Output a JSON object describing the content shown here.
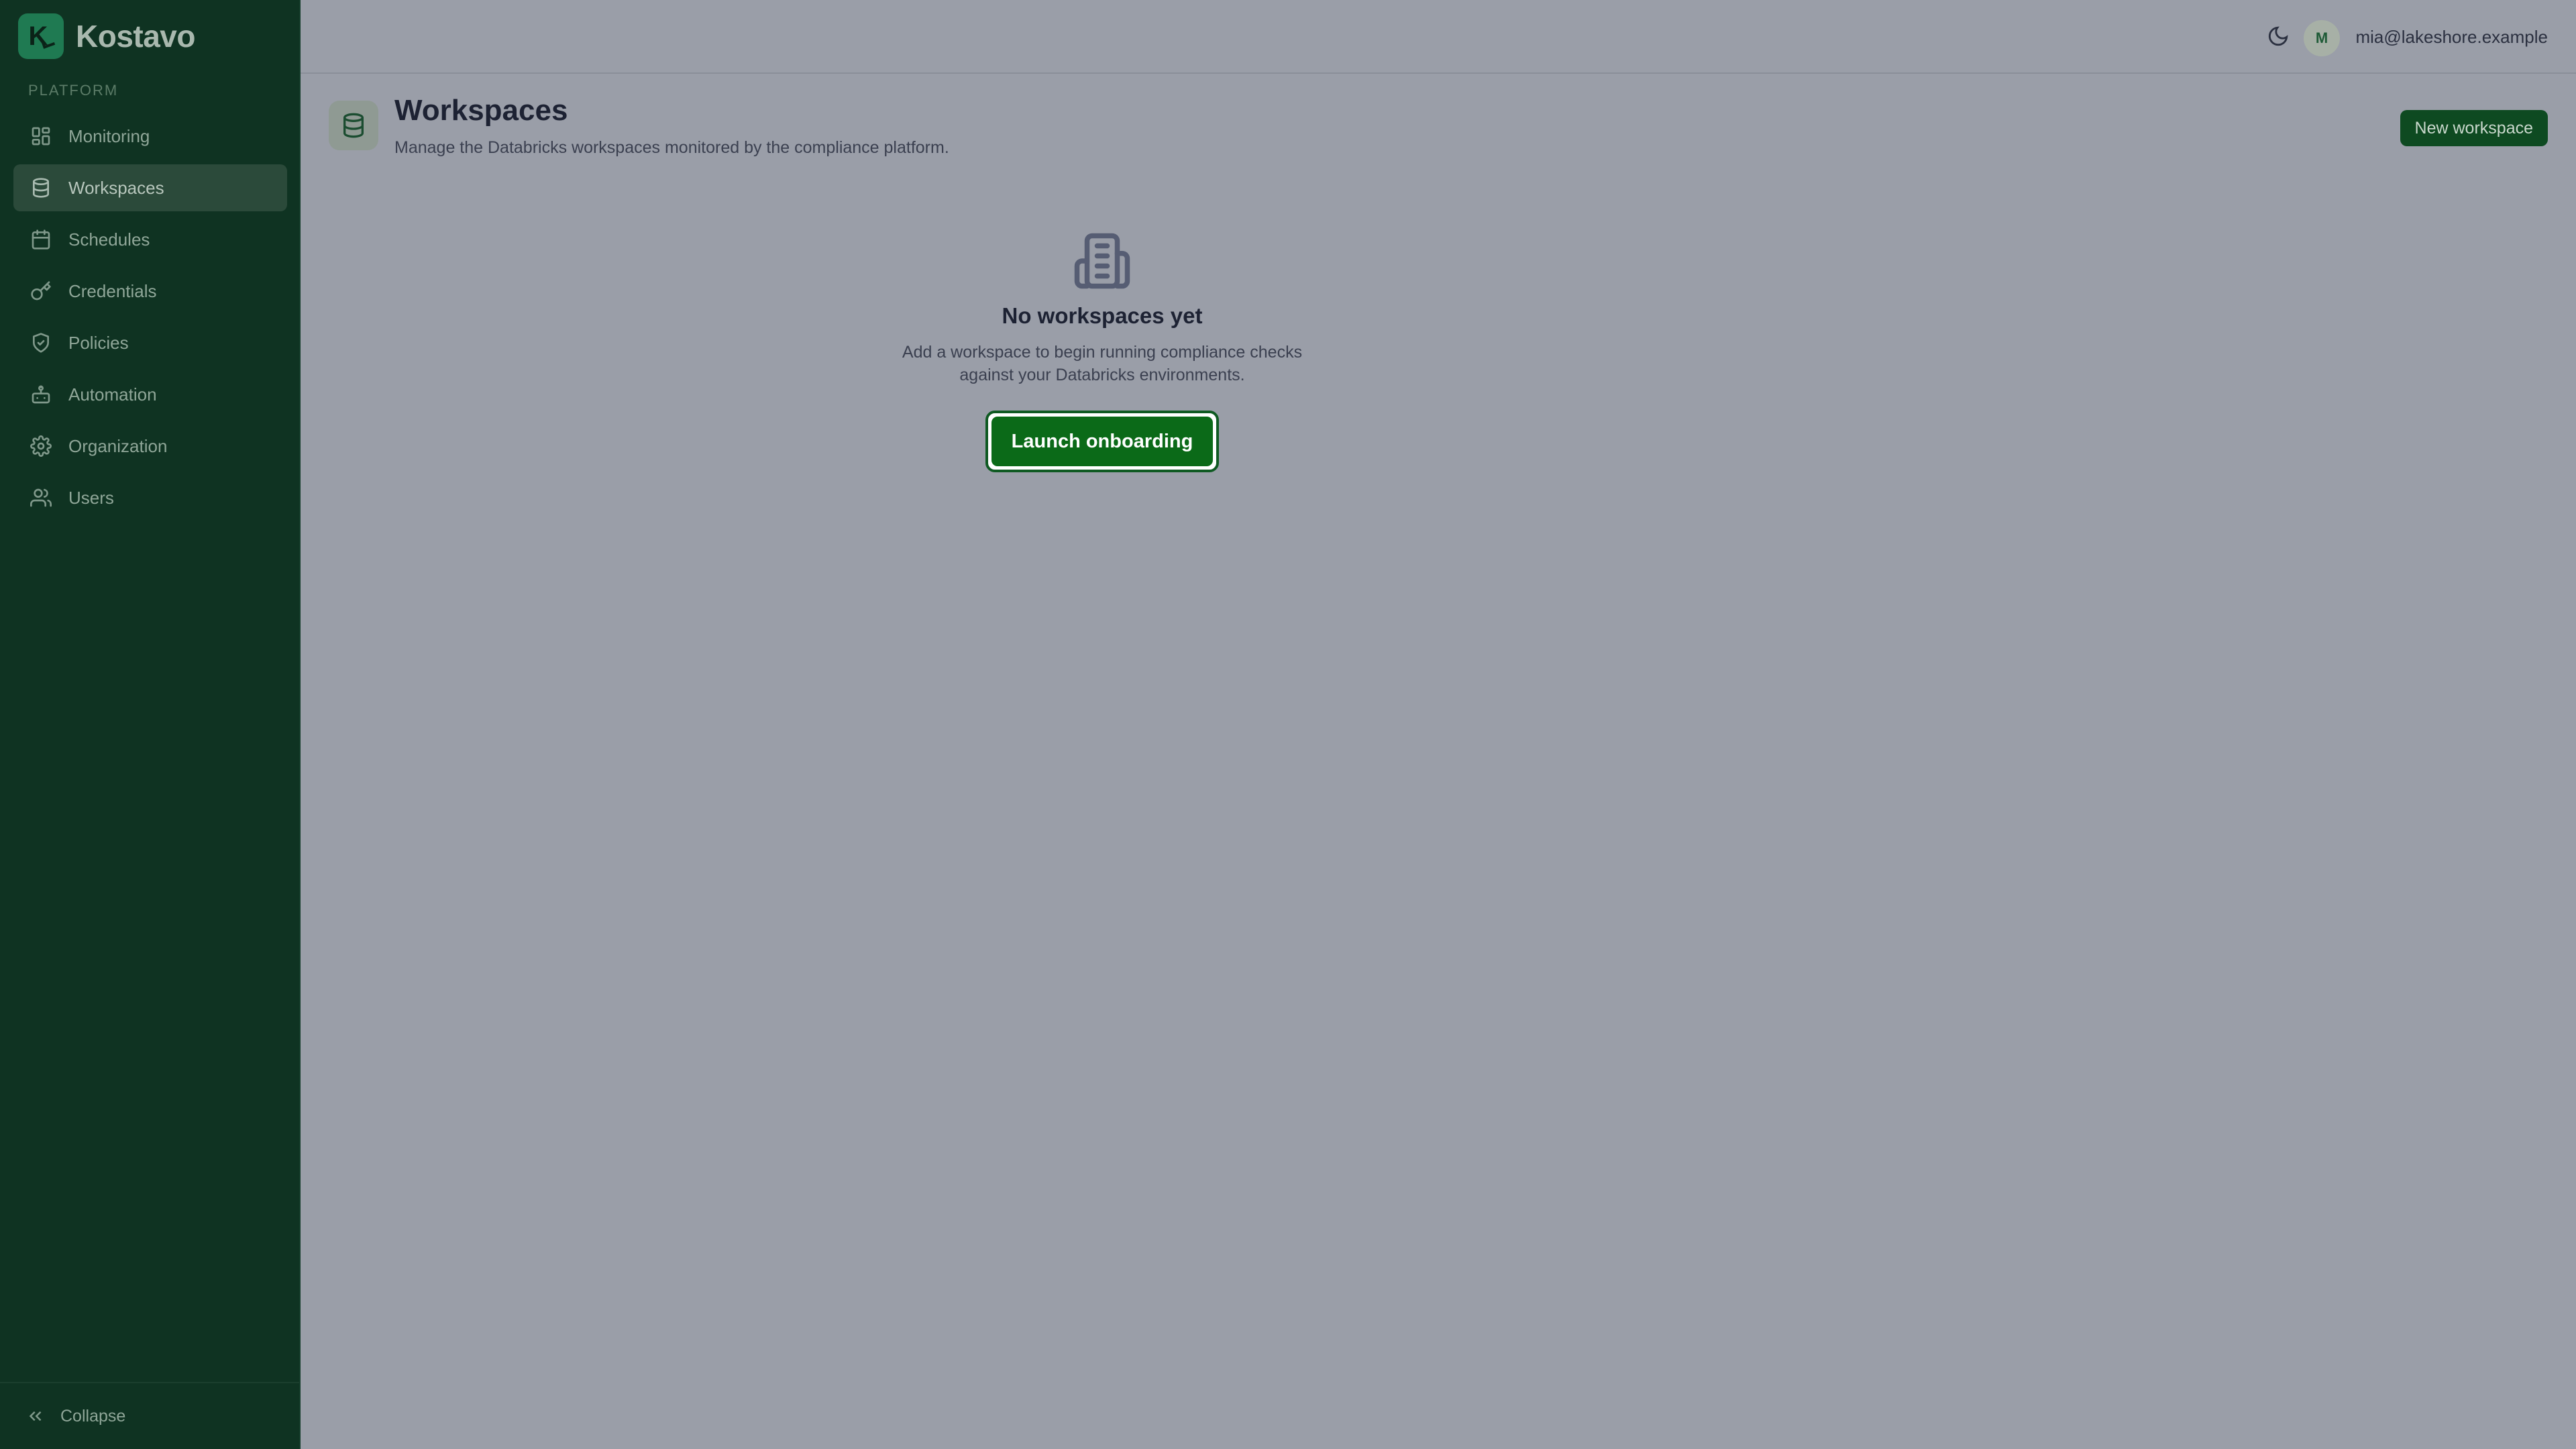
{
  "app": {
    "name": "Kostavo",
    "logo_letter": "K"
  },
  "sidebar": {
    "section_label": "PLATFORM",
    "items": [
      {
        "label": "Monitoring",
        "icon": "grid-icon"
      },
      {
        "label": "Workspaces",
        "icon": "database-icon",
        "active": true
      },
      {
        "label": "Schedules",
        "icon": "calendar-icon"
      },
      {
        "label": "Credentials",
        "icon": "key-icon"
      },
      {
        "label": "Policies",
        "icon": "shield-icon"
      },
      {
        "label": "Automation",
        "icon": "bot-icon"
      },
      {
        "label": "Organization",
        "icon": "gear-icon"
      },
      {
        "label": "Users",
        "icon": "users-icon"
      }
    ],
    "collapse_label": "Collapse"
  },
  "topbar": {
    "avatar_initial": "M",
    "user_email": "mia@lakeshore.example"
  },
  "page": {
    "title": "Workspaces",
    "subtitle": "Manage the Databricks workspaces monitored by the compliance platform.",
    "new_button": "New workspace"
  },
  "empty_state": {
    "title": "No workspaces yet",
    "description": "Add a workspace to begin running compliance checks against your Databricks environments.",
    "button": "Launch onboarding"
  },
  "colors": {
    "sidebar_bg": "#0f3322",
    "page_bg": "#9a9ea8",
    "accent": "#0b6a18"
  }
}
